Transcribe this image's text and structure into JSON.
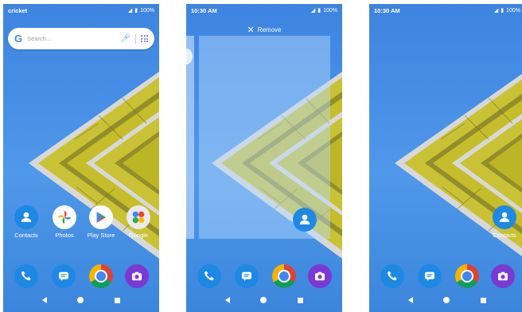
{
  "screens": [
    {
      "status": {
        "left": "cricket",
        "right": "100%"
      },
      "search": {
        "placeholder": "Search..."
      },
      "apps": [
        {
          "label": "Contacts",
          "icon": "contacts-icon"
        },
        {
          "label": "Photos",
          "icon": "photos-icon"
        },
        {
          "label": "Play Store",
          "icon": "play-store-icon"
        },
        {
          "label": "Google",
          "icon": "google-folder-icon"
        }
      ],
      "dock": [
        "phone-icon",
        "messages-icon",
        "chrome-icon",
        "camera-icon"
      ]
    },
    {
      "status": {
        "left": "10:30 AM",
        "right": "100%"
      },
      "remove_label": "Remove",
      "dock": [
        "phone-icon",
        "messages-icon",
        "chrome-icon",
        "camera-icon"
      ]
    },
    {
      "status": {
        "left": "10:30 AM",
        "right": "100%"
      },
      "apps": [
        {
          "label": "Contacts",
          "icon": "contacts-icon"
        }
      ],
      "dock": [
        "phone-icon",
        "messages-icon",
        "chrome-icon",
        "camera-icon"
      ]
    }
  ],
  "colors": {
    "wallpaper_blue": "#4f98ea",
    "building_yellow": "#c9c234",
    "accent_blue": "#1e88e5",
    "camera_purple": "#7b39d4"
  }
}
